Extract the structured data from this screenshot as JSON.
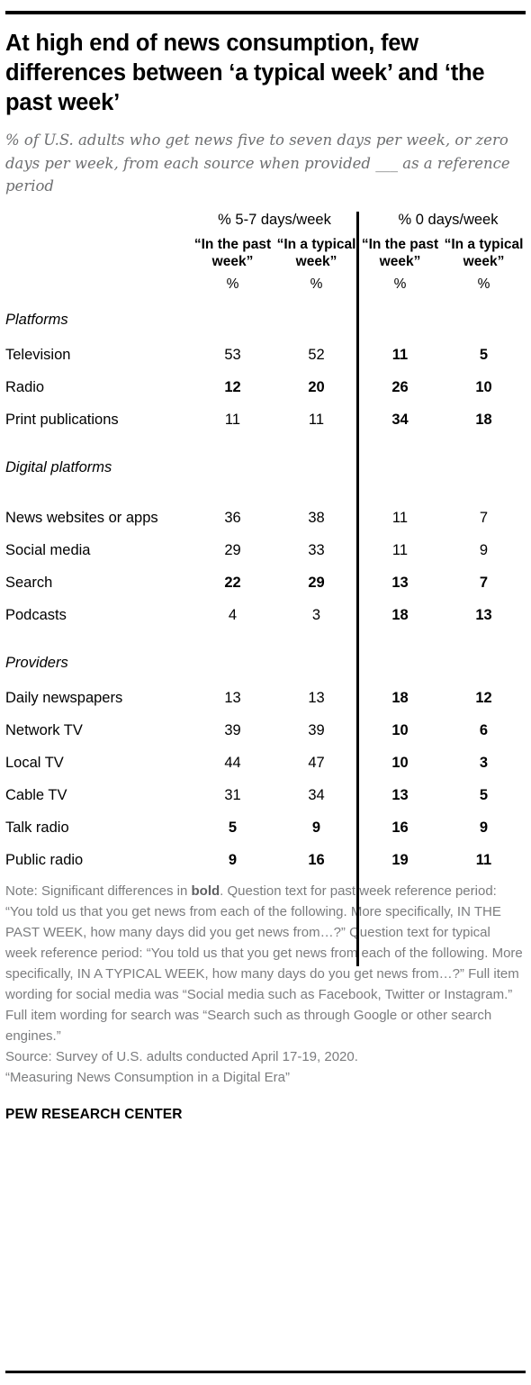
{
  "title": "At high end of news consumption, few differences between ‘a typical week’ and ‘the past week’",
  "subtitle": "% of U.S. adults who get news five to seven days per week, or zero days per week, from each source when provided ___ as a reference period",
  "header": {
    "group_left": "% 5-7 days/week",
    "group_right": "% 0 days/week",
    "col1": "“In the past week”",
    "col2": "“In a typical week”",
    "col3": "“In the past week”",
    "col4": "“In a typical week”",
    "unit1": "%",
    "unit2": "%",
    "unit3": "%",
    "unit4": "%"
  },
  "sections": {
    "platforms": "Platforms",
    "digital": "Digital platforms",
    "providers": "Providers"
  },
  "rows": {
    "television": {
      "label": "Television",
      "v1": "53",
      "v2": "52",
      "v3": "11",
      "v4": "5",
      "b1": false,
      "b2": false,
      "b3": true,
      "b4": true
    },
    "radio": {
      "label": "Radio",
      "v1": "12",
      "v2": "20",
      "v3": "26",
      "v4": "10",
      "b1": true,
      "b2": true,
      "b3": true,
      "b4": true
    },
    "print": {
      "label": "Print publications",
      "v1": "11",
      "v2": "11",
      "v3": "34",
      "v4": "18",
      "b1": false,
      "b2": false,
      "b3": true,
      "b4": true
    },
    "news_websites": {
      "label": "News websites or apps",
      "v1": "36",
      "v2": "38",
      "v3": "11",
      "v4": "7",
      "b1": false,
      "b2": false,
      "b3": false,
      "b4": false
    },
    "social_media": {
      "label": "Social media",
      "v1": "29",
      "v2": "33",
      "v3": "11",
      "v4": "9",
      "b1": false,
      "b2": false,
      "b3": false,
      "b4": false
    },
    "search": {
      "label": "Search",
      "v1": "22",
      "v2": "29",
      "v3": "13",
      "v4": "7",
      "b1": true,
      "b2": true,
      "b3": true,
      "b4": true
    },
    "podcasts": {
      "label": "Podcasts",
      "v1": "4",
      "v2": "3",
      "v3": "18",
      "v4": "13",
      "b1": false,
      "b2": false,
      "b3": true,
      "b4": true
    },
    "daily_newspapers": {
      "label": "Daily newspapers",
      "v1": "13",
      "v2": "13",
      "v3": "18",
      "v4": "12",
      "b1": false,
      "b2": false,
      "b3": true,
      "b4": true
    },
    "network_tv": {
      "label": "Network TV",
      "v1": "39",
      "v2": "39",
      "v3": "10",
      "v4": "6",
      "b1": false,
      "b2": false,
      "b3": true,
      "b4": true
    },
    "local_tv": {
      "label": "Local TV",
      "v1": "44",
      "v2": "47",
      "v3": "10",
      "v4": "3",
      "b1": false,
      "b2": false,
      "b3": true,
      "b4": true
    },
    "cable_tv": {
      "label": "Cable TV",
      "v1": "31",
      "v2": "34",
      "v3": "13",
      "v4": "5",
      "b1": false,
      "b2": false,
      "b3": true,
      "b4": true
    },
    "talk_radio": {
      "label": "Talk radio",
      "v1": "5",
      "v2": "9",
      "v3": "16",
      "v4": "9",
      "b1": true,
      "b2": true,
      "b3": true,
      "b4": true
    },
    "public_radio": {
      "label": "Public radio",
      "v1": "9",
      "v2": "16",
      "v3": "19",
      "v4": "11",
      "b1": true,
      "b2": true,
      "b3": true,
      "b4": true
    }
  },
  "notes": {
    "note_a": "Note: Significant differences in ",
    "note_bold": "bold",
    "note_b": ". Question text for past week reference period: “You told us that you get news from each of the following. More specifically, IN THE PAST WEEK, how many days did you get news from…?” Question text for typical week reference period: “You told us that you get news from each of the following. More specifically, IN A TYPICAL WEEK, how many days do you get news from…?” Full item wording for social media was “Social media such as Facebook, Twitter or Instagram.” Full item wording for search was “Search such as through Google or other search engines.”",
    "source": "Source: Survey of U.S. adults conducted April 17-19, 2020.",
    "study": "“Measuring News Consumption in a Digital Era”",
    "org": "PEW RESEARCH CENTER"
  },
  "chart_data": {
    "type": "table",
    "title": "At high end of news consumption, few differences between ‘a typical week’ and ‘the past week’",
    "subtitle": "% of U.S. adults who get news five to seven days per week, or zero days per week, from each source when provided ___ as a reference period",
    "column_groups": [
      "% 5-7 days/week",
      "% 0 days/week"
    ],
    "columns": [
      "“In the past week”",
      "“In a typical week”",
      "“In the past week”",
      "“In a typical week”"
    ],
    "units": [
      "%",
      "%",
      "%",
      "%"
    ],
    "sections": [
      {
        "name": "Platforms",
        "rows": [
          {
            "label": "Television",
            "values": [
              53,
              52,
              11,
              5
            ],
            "bold": [
              false,
              false,
              true,
              true
            ]
          },
          {
            "label": "Radio",
            "values": [
              12,
              20,
              26,
              10
            ],
            "bold": [
              true,
              true,
              true,
              true
            ]
          },
          {
            "label": "Print publications",
            "values": [
              11,
              11,
              34,
              18
            ],
            "bold": [
              false,
              false,
              true,
              true
            ]
          }
        ]
      },
      {
        "name": "Digital platforms",
        "rows": [
          {
            "label": "News websites or apps",
            "values": [
              36,
              38,
              11,
              7
            ],
            "bold": [
              false,
              false,
              false,
              false
            ]
          },
          {
            "label": "Social media",
            "values": [
              29,
              33,
              11,
              9
            ],
            "bold": [
              false,
              false,
              false,
              false
            ]
          },
          {
            "label": "Search",
            "values": [
              22,
              29,
              13,
              7
            ],
            "bold": [
              true,
              true,
              true,
              true
            ]
          },
          {
            "label": "Podcasts",
            "values": [
              4,
              3,
              18,
              13
            ],
            "bold": [
              false,
              false,
              true,
              true
            ]
          }
        ]
      },
      {
        "name": "Providers",
        "rows": [
          {
            "label": "Daily newspapers",
            "values": [
              13,
              13,
              18,
              12
            ],
            "bold": [
              false,
              false,
              true,
              true
            ]
          },
          {
            "label": "Network TV",
            "values": [
              39,
              39,
              10,
              6
            ],
            "bold": [
              false,
              false,
              true,
              true
            ]
          },
          {
            "label": "Local TV",
            "values": [
              44,
              47,
              10,
              3
            ],
            "bold": [
              false,
              false,
              true,
              true
            ]
          },
          {
            "label": "Cable TV",
            "values": [
              31,
              34,
              13,
              5
            ],
            "bold": [
              false,
              false,
              true,
              true
            ]
          },
          {
            "label": "Talk radio",
            "values": [
              5,
              9,
              16,
              9
            ],
            "bold": [
              true,
              true,
              true,
              true
            ]
          },
          {
            "label": "Public radio",
            "values": [
              9,
              16,
              19,
              11
            ],
            "bold": [
              true,
              true,
              true,
              true
            ]
          }
        ]
      }
    ],
    "source": "Source: Survey of U.S. adults conducted April 17-19, 2020.",
    "study": "“Measuring News Consumption in a Digital Era”",
    "org": "PEW RESEARCH CENTER"
  }
}
